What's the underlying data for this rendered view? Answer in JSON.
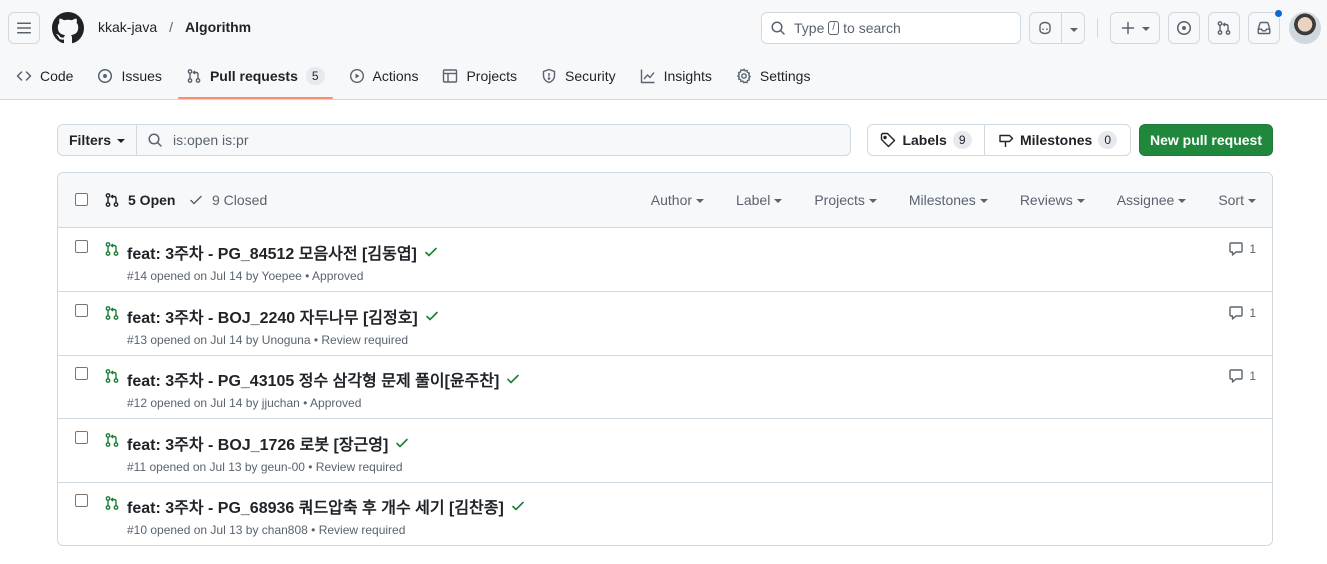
{
  "header": {
    "owner": "kkak-java",
    "separator": "/",
    "repo": "Algorithm",
    "search_prefix": "Type",
    "search_key": "/",
    "search_suffix": "to search"
  },
  "tabs": [
    {
      "label": "Code",
      "icon": "code-icon"
    },
    {
      "label": "Issues",
      "icon": "issue-opened-icon"
    },
    {
      "label": "Pull requests",
      "icon": "git-pull-request-icon",
      "count": "5",
      "selected": true
    },
    {
      "label": "Actions",
      "icon": "play-icon"
    },
    {
      "label": "Projects",
      "icon": "table-icon"
    },
    {
      "label": "Security",
      "icon": "shield-icon"
    },
    {
      "label": "Insights",
      "icon": "graph-icon"
    },
    {
      "label": "Settings",
      "icon": "gear-icon"
    }
  ],
  "filterbar": {
    "filters_label": "Filters",
    "query": "is:open is:pr",
    "labels_label": "Labels",
    "labels_count": "9",
    "milestones_label": "Milestones",
    "milestones_count": "0",
    "new_pr_label": "New pull request"
  },
  "list": {
    "open_label": "5 Open",
    "closed_label": "9 Closed",
    "menus": [
      "Author",
      "Label",
      "Projects",
      "Milestones",
      "Reviews",
      "Assignee",
      "Sort"
    ],
    "items": [
      {
        "title": "feat: 3주차 - PG_84512 모음사전 [김동엽]",
        "meta": "#14 opened on Jul 14 by Yoepee • Approved",
        "comments": "1"
      },
      {
        "title": "feat: 3주차 - BOJ_2240 자두나무 [김정호]",
        "meta": "#13 opened on Jul 14 by Unoguna • Review required",
        "comments": "1"
      },
      {
        "title": "feat: 3주차 - PG_43105 정수 삼각형 문제 풀이[윤주찬]",
        "meta": "#12 opened on Jul 14 by jjuchan • Approved",
        "comments": "1"
      },
      {
        "title": "feat: 3주차 - BOJ_1726 로봇 [장근영]",
        "meta": "#11 opened on Jul 13 by geun-00 • Review required",
        "comments": ""
      },
      {
        "title": "feat: 3주차 - PG_68936 쿼드압축 후 개수 세기 [김찬종]",
        "meta": "#10 opened on Jul 13 by chan808 • Review required",
        "comments": ""
      }
    ]
  },
  "colors": {
    "accent_green": "#1f883d",
    "tab_underline": "#fd8c73",
    "notification_dot": "#0969da"
  }
}
